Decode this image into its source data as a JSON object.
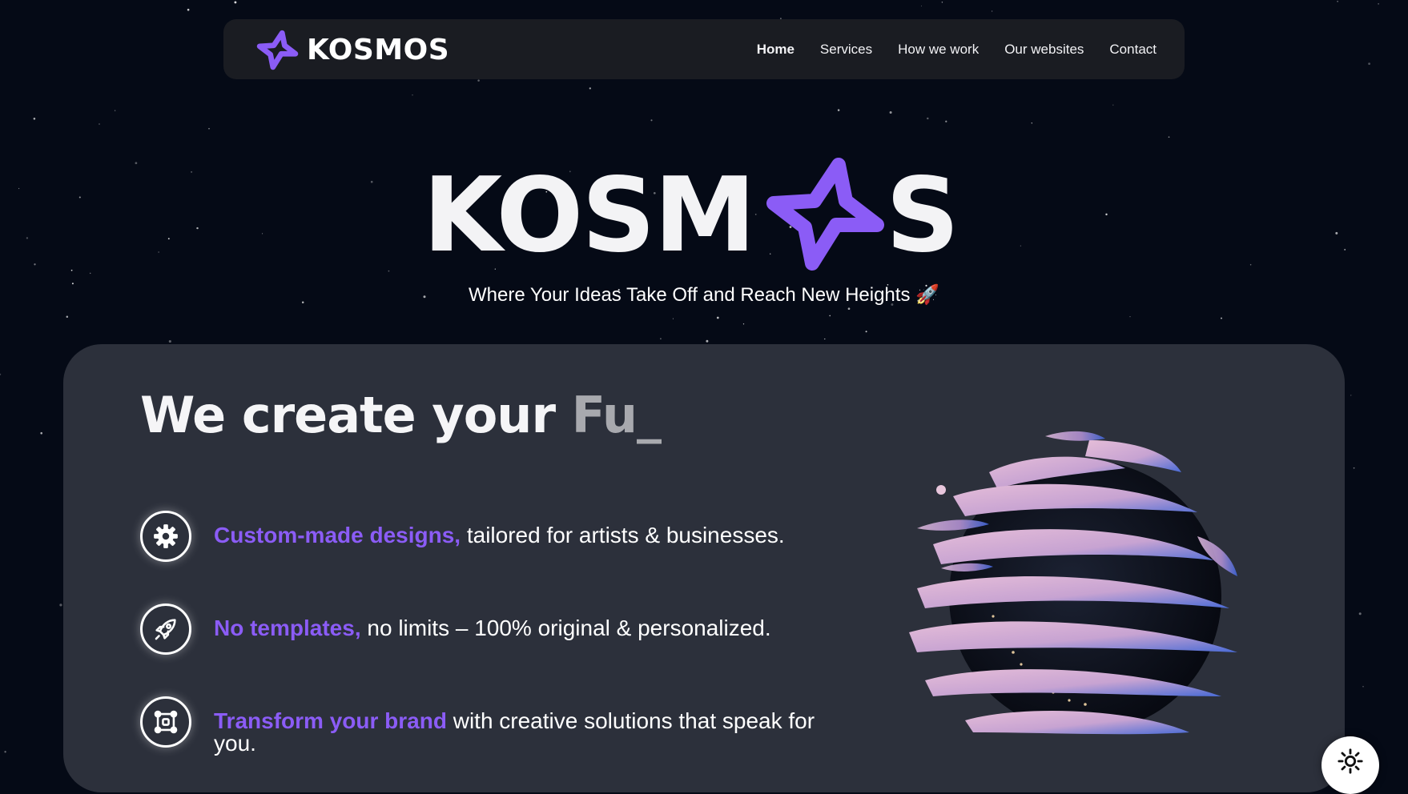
{
  "nav": {
    "logo_text": "KOSMOS",
    "links": [
      {
        "label": "Home",
        "active": true
      },
      {
        "label": "Services",
        "active": false
      },
      {
        "label": "How we work",
        "active": false
      },
      {
        "label": "Our websites",
        "active": false
      },
      {
        "label": "Contact",
        "active": false
      }
    ]
  },
  "hero": {
    "title_left": "KOSM",
    "title_right": "S",
    "tagline": "Where Your Ideas Take Off and Reach New Heights 🚀"
  },
  "card": {
    "headline_static": "We create your ",
    "headline_typed": "Fu_",
    "features": [
      {
        "icon": "gear-icon",
        "highlight": "Custom-made designs,",
        "text": " tailored for artists & businesses."
      },
      {
        "icon": "rocket-icon",
        "highlight": "No templates,",
        "text": " no limits – 100% original & personalized."
      },
      {
        "icon": "frame-icon",
        "highlight": "Transform your brand",
        "text": " with creative solutions that speak for you."
      }
    ]
  },
  "theme_toggle": {
    "icon": "sun-icon"
  },
  "colors": {
    "background": "#050a16",
    "nav_background": "#1a1c22",
    "card_background": "#2c303b",
    "accent": "#8b5cf6",
    "text": "#f5f5f7",
    "typed_text": "#a8a9ae"
  }
}
